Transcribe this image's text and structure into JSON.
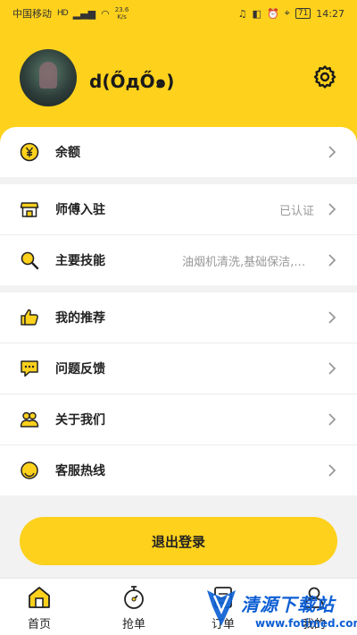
{
  "status_bar": {
    "carrier": "中国移动",
    "net_badge": "HD",
    "speed": "23.6",
    "speed_unit": "K/s",
    "battery": "71",
    "time": "14:27"
  },
  "profile": {
    "username": "d(ŐдŐ๑)"
  },
  "menu": {
    "balance": {
      "label": "余额",
      "icon": "yuan-coin-icon"
    },
    "master_join": {
      "label": "师傅入驻",
      "value": "已认证",
      "icon": "shop-icon"
    },
    "main_skills": {
      "label": "主要技能",
      "value": "油烟机清洗,基础保洁,地暖清洗,...",
      "icon": "magnify-icon"
    },
    "recommend": {
      "label": "我的推荐",
      "icon": "thumbs-up-icon"
    },
    "feedback": {
      "label": "问题反馈",
      "icon": "chat-icon"
    },
    "about": {
      "label": "关于我们",
      "icon": "people-icon"
    },
    "hotline": {
      "label": "客服热线",
      "icon": "headset-icon"
    }
  },
  "logout_label": "退出登录",
  "tabs": [
    {
      "label": "首页",
      "icon": "home-icon"
    },
    {
      "label": "抢单",
      "icon": "stopwatch-icon"
    },
    {
      "label": "订单",
      "icon": "order-icon"
    },
    {
      "label": "我的",
      "icon": "user-icon"
    }
  ],
  "watermark": {
    "text": "清源下载站",
    "url": "www.fotimed.com"
  },
  "colors": {
    "accent": "#fdd11c",
    "background": "#f2f2f2",
    "watermark": "#0d5fd4"
  }
}
